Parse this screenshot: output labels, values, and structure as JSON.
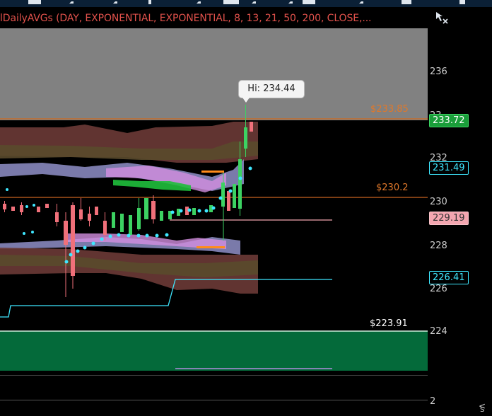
{
  "study": {
    "title": "lDailyAVGs (DAY, EXPONENTIAL, EXPONENTIAL, 8, 13, 21, 50, 200, CLOSE,..."
  },
  "axis": {
    "ticks": [
      "236",
      "232",
      "230",
      "228",
      "226",
      "224",
      "2"
    ],
    "partial_tick": "23",
    "bottom_corner_label": "S",
    "bottom_corner_glyph": "<"
  },
  "price_badges": [
    {
      "label": "233.72",
      "style": "green"
    },
    {
      "label": "231.49",
      "style": "cyan"
    },
    {
      "label": "229.19",
      "style": "pink"
    },
    {
      "label": "226.41",
      "style": "cyan"
    }
  ],
  "levels": [
    {
      "label": "$233.85",
      "color": "#e0782a"
    },
    {
      "label": "$230.2",
      "color": "#e0782a"
    },
    {
      "label": "$223.91",
      "color": "#ffffff"
    }
  ],
  "tooltip": {
    "label": "Hi: 234.44"
  },
  "icons": {
    "draw_tool": "drawing-cursor-icon"
  },
  "colors": {
    "title": "#e0514b",
    "background": "#000000",
    "green_zone": "#046a3a",
    "cyan": "#3ee7ff",
    "orange": "#e0782a",
    "up_candle": "#3cd262",
    "down_candle": "#f0707a"
  }
}
